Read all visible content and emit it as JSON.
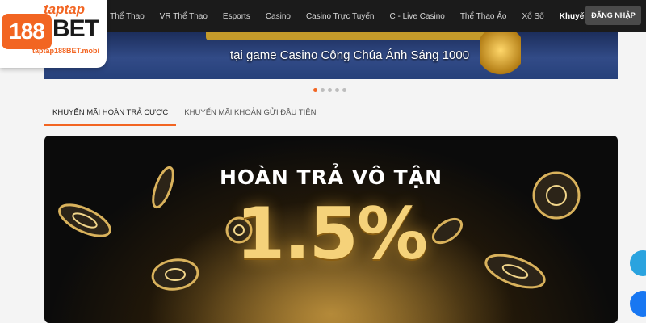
{
  "logo": {
    "top": "taptap",
    "number": "188",
    "bet": "BET",
    "url": "taptap188BET.mobi"
  },
  "nav": {
    "items": [
      {
        "label": "BTI Thể Thao"
      },
      {
        "label": "VR Thể Thao"
      },
      {
        "label": "Esports"
      },
      {
        "label": "Casino"
      },
      {
        "label": "Casino Trực Tuyến"
      },
      {
        "label": "C - Live Casino"
      },
      {
        "label": "Thể Thao Ảo"
      },
      {
        "label": "Xổ Số"
      },
      {
        "label": "Khuyến Mãi",
        "active": true
      }
    ],
    "login_label": "ĐĂNG NHẬP"
  },
  "banner": {
    "text": "tại game Casino Công Chúa Ánh Sáng 1000"
  },
  "carousel": {
    "dots": 5,
    "active_index": 0
  },
  "tabs": [
    {
      "label": "KHUYẾN MÃI HOÀN TRẢ CƯỢC",
      "active": true
    },
    {
      "label": "KHUYẾN MÃI KHOẢN GỬI ĐẦU TIÊN",
      "active": false
    }
  ],
  "promo": {
    "title": "HOÀN TRẢ VÔ TẬN",
    "value": "1.5%"
  },
  "colors": {
    "accent": "#f26522",
    "topbar": "#1b1b1b",
    "gold": "#f5d27a"
  },
  "floating": [
    {
      "icon": "telegram-icon"
    },
    {
      "icon": "messenger-icon"
    }
  ]
}
